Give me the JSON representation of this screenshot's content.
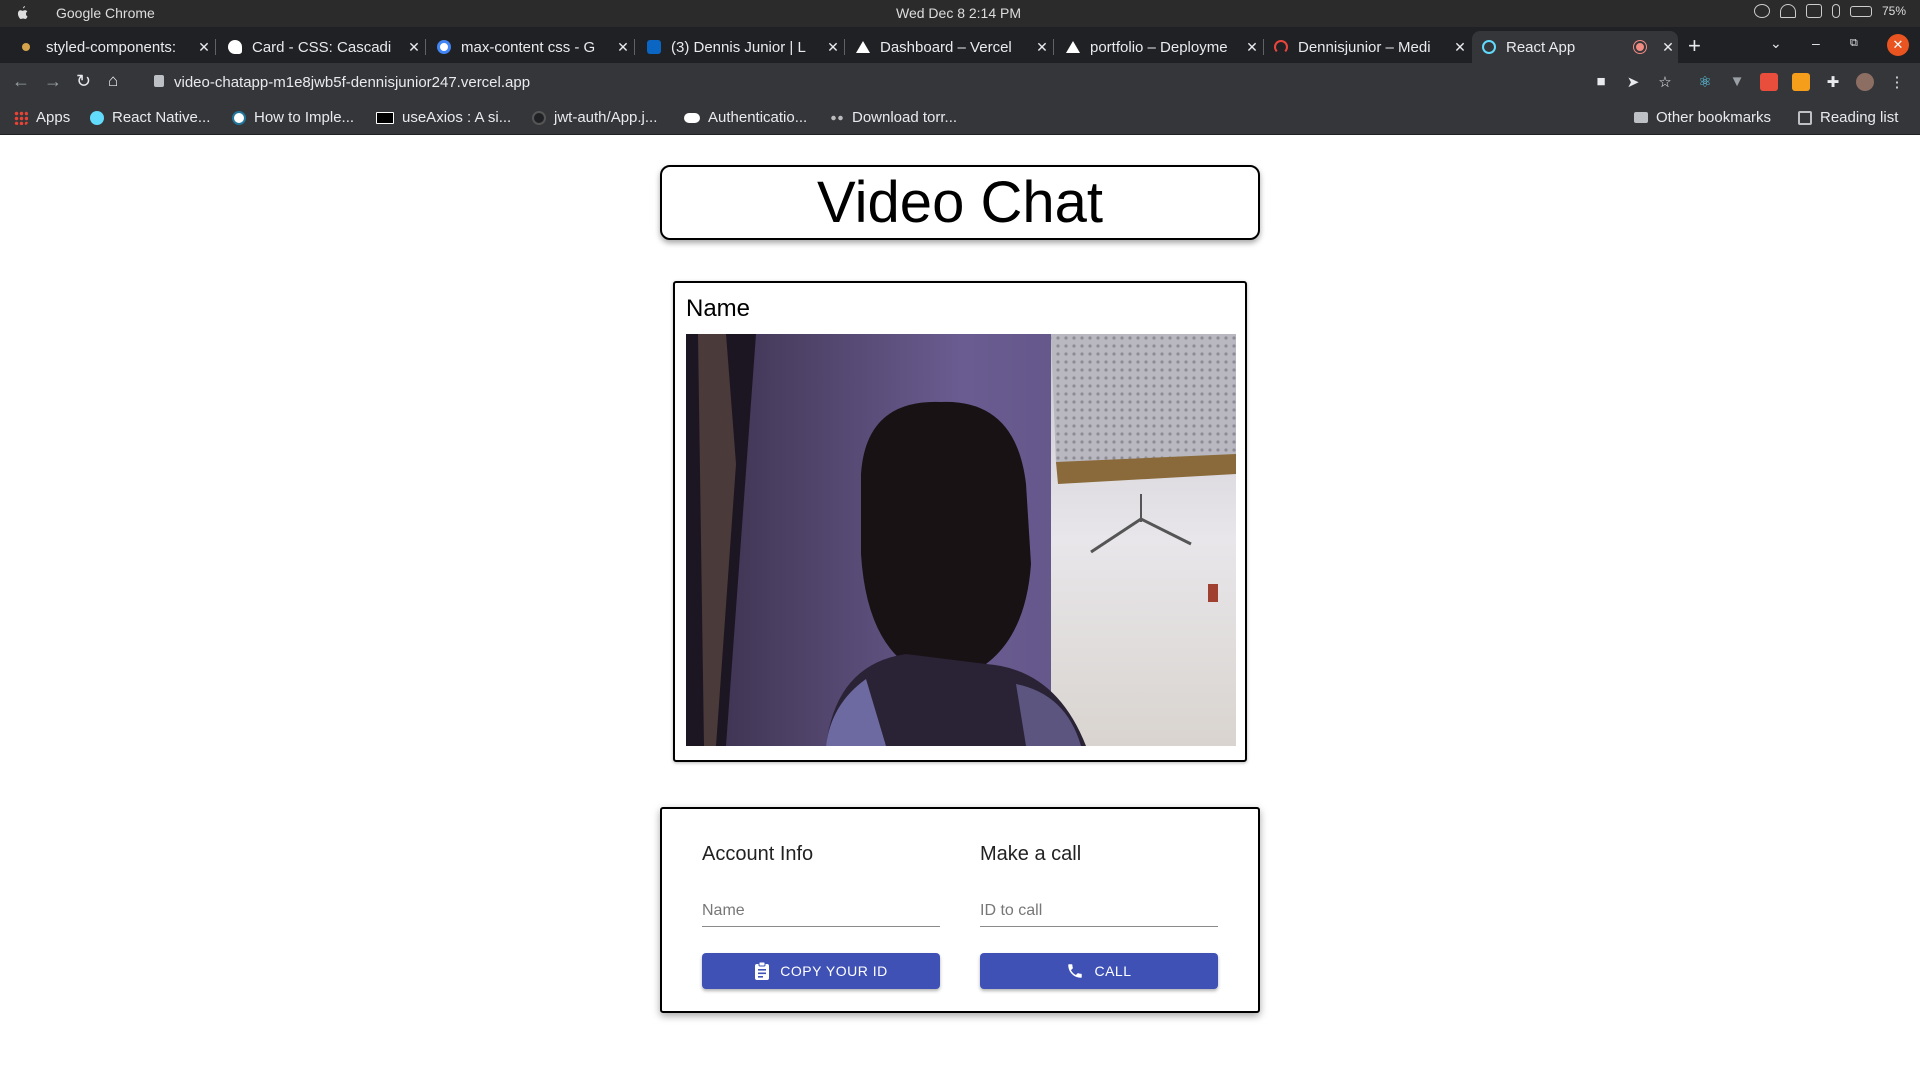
{
  "menubar": {
    "app_name": "Google Chrome",
    "datetime": "Wed Dec 8   2:14 PM",
    "battery": "75%"
  },
  "tabs": [
    {
      "title": "styled-components:",
      "favicon": "styled-components-icon",
      "color": "#d6a54b"
    },
    {
      "title": "Card - CSS: Cascadi",
      "favicon": "mdn-icon",
      "color": "#ffffff"
    },
    {
      "title": "max-content css - G",
      "favicon": "google-icon",
      "color": "#4285f4"
    },
    {
      "title": "(3) Dennis Junior | L",
      "favicon": "linkedin-icon",
      "color": "#0a66c2"
    },
    {
      "title": "Dashboard – Vercel",
      "favicon": "vercel-icon",
      "color": "#ffffff"
    },
    {
      "title": "portfolio – Deployme",
      "favicon": "vercel-icon",
      "color": "#ffffff"
    },
    {
      "title": "Dennisjunior – Medi",
      "favicon": "loading-icon",
      "color": "#e8453c"
    },
    {
      "title": "React App",
      "favicon": "react-icon",
      "color": "#61dafb",
      "active": true
    }
  ],
  "address_bar": {
    "url": "video-chatapp-m1e8jwb5f-dennisjunior247.vercel.app"
  },
  "bookmarks": [
    {
      "label": "Apps",
      "icon": "apps-grid-icon"
    },
    {
      "label": "React Native...",
      "icon": "react-icon"
    },
    {
      "label": "How to Imple...",
      "icon": "wordpress-icon"
    },
    {
      "label": "useAxios : A si...",
      "icon": "dev-icon"
    },
    {
      "label": "jwt-auth/App.j...",
      "icon": "github-icon"
    },
    {
      "label": "Authenticatio...",
      "icon": "medium-icon"
    },
    {
      "label": "Download torr...",
      "icon": "eyes-icon"
    }
  ],
  "bookmarks_right": {
    "other": "Other bookmarks",
    "reading": "Reading list"
  },
  "page": {
    "title": "Video Chat",
    "video_name": "Name",
    "account": {
      "heading": "Account Info",
      "name_placeholder": "Name",
      "copy_button": "COPY YOUR ID"
    },
    "call": {
      "heading": "Make a call",
      "id_placeholder": "ID to call",
      "call_button": "CALL"
    }
  },
  "colors": {
    "primary_button": "#3f51b5",
    "chrome_dark": "#202124",
    "chrome_toolbar": "#35363a"
  }
}
